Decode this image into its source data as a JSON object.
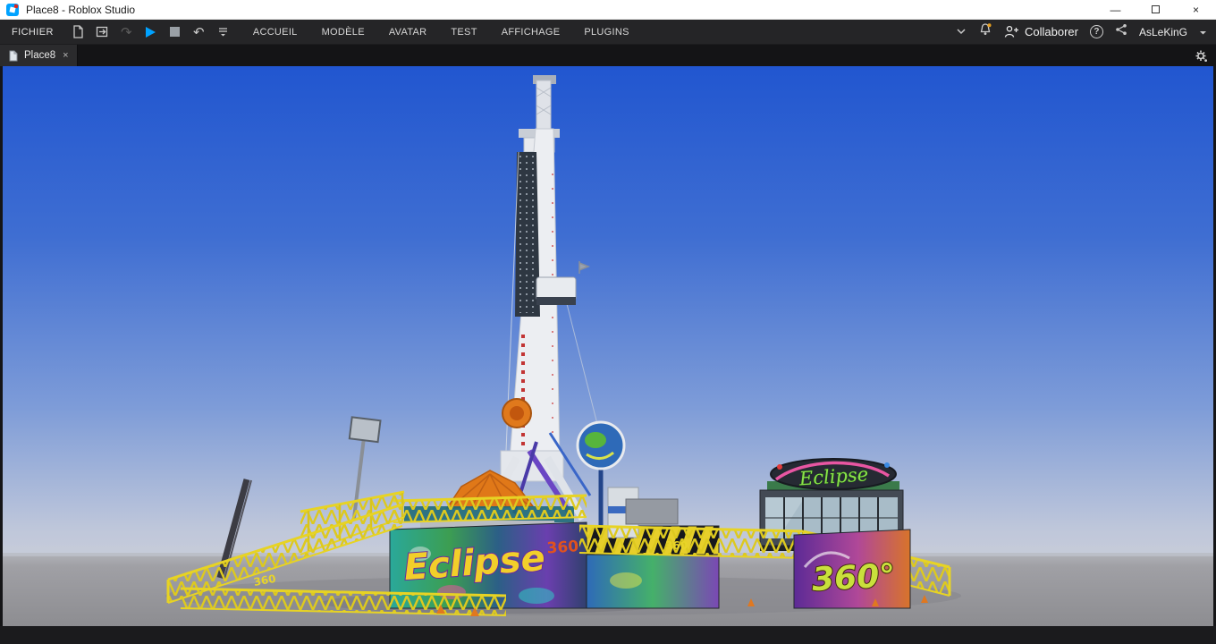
{
  "window": {
    "title": "Place8 - Roblox Studio"
  },
  "icons": {
    "minimize_glyph": "—",
    "close_glyph": "×",
    "undo_glyph": "↶",
    "redo_glyph": "↷",
    "question_glyph": "?"
  },
  "ribbon": {
    "file_label": "FICHIER",
    "menu_tabs": [
      "ACCUEIL",
      "MODÈLE",
      "AVATAR",
      "TEST",
      "AFFICHAGE",
      "PLUGINS"
    ],
    "collaborate_label": "Collaborer",
    "username": "AsLeKinG"
  },
  "tabbar": {
    "active_tab": "Place8"
  },
  "scene": {
    "labels": {
      "booth_sign": "Eclipse",
      "base_graffiti": "Eclipse",
      "base_number": "360",
      "right_panel_number": "360°",
      "fence_number_left": "360",
      "fence_number_right": "360"
    },
    "colors": {
      "sky_top": "#2156d0",
      "sky_horizon": "#c6cbdb",
      "ground": "#97979b",
      "truss_yellow": "#ddc91f",
      "canopy_orange": "#e07818",
      "play_blue": "#00a2ff"
    }
  }
}
